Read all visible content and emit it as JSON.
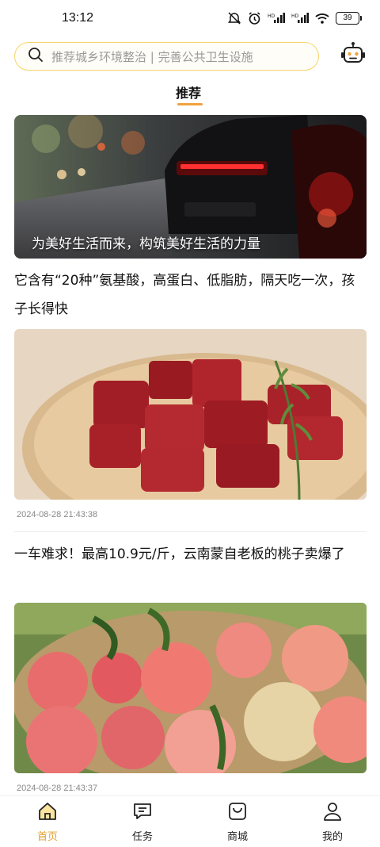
{
  "status_bar": {
    "time": "13:12",
    "battery": "39",
    "icons": [
      "mute-icon",
      "alarm-icon",
      "hd-signal-icon",
      "hd-signal-icon",
      "wifi-icon",
      "battery-icon"
    ]
  },
  "search": {
    "placeholder": "推荐城乡环境整治 | 完善公共卫生设施"
  },
  "tabs": [
    {
      "label": "推荐",
      "active": true
    }
  ],
  "banner": {
    "caption": "为美好生活而来，构筑美好生活的力量"
  },
  "feed": [
    {
      "title": "它含有“20种”氨基酸，高蛋白、低脂肪，隔天吃一次，孩子长得快",
      "date": "2024-08-28 21:43:38"
    },
    {
      "title": "一车难求！最高10.9元/斤，云南蒙自老板的桃子卖爆了",
      "date": "2024-08-28 21:43:37"
    }
  ],
  "bottom_nav": [
    {
      "label": "首页",
      "icon": "home-icon",
      "active": true
    },
    {
      "label": "任务",
      "icon": "task-icon",
      "active": false
    },
    {
      "label": "商城",
      "icon": "shop-bag-icon",
      "active": false
    },
    {
      "label": "我的",
      "icon": "user-icon",
      "active": false
    }
  ],
  "colors": {
    "accent": "#f1a23c",
    "search_border": "#f5d56a",
    "nav_active": "#e0a030"
  }
}
